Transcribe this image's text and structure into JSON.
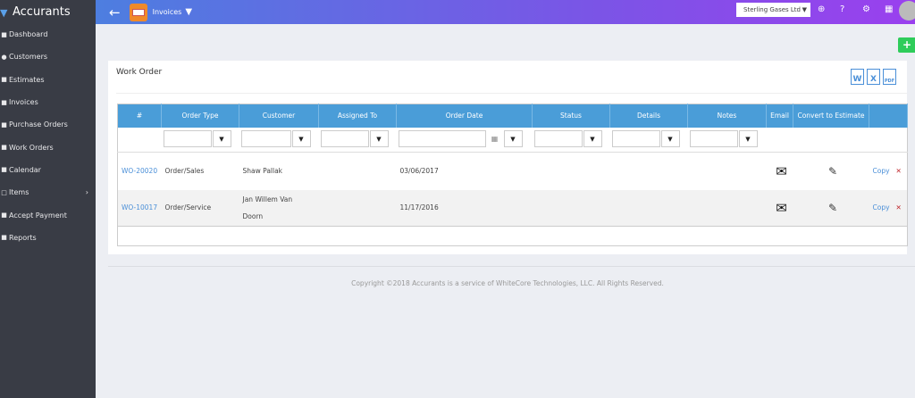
{
  "brand": "Accurants",
  "sidebar": {
    "items": [
      {
        "label": "Dashboard",
        "icon": "dashboard-icon"
      },
      {
        "label": "Customers",
        "icon": "user-icon"
      },
      {
        "label": "Estimates",
        "icon": "estimate-icon"
      },
      {
        "label": "Invoices",
        "icon": "invoice-icon"
      },
      {
        "label": "Purchase Orders",
        "icon": "purchase-icon"
      },
      {
        "label": "Work Orders",
        "icon": "workorder-icon"
      },
      {
        "label": "Calendar",
        "icon": "calendar-icon"
      },
      {
        "label": "Items",
        "icon": "items-icon",
        "has_submenu": true
      },
      {
        "label": "Accept Payment",
        "icon": "payment-icon"
      },
      {
        "label": "Reports",
        "icon": "reports-icon"
      }
    ]
  },
  "topbar": {
    "title": "Invoices",
    "company": "Sterling Gases Ltd",
    "colors": {
      "start": "#4d7ee0",
      "end": "#9a40ee"
    }
  },
  "card": {
    "title": "Work Order",
    "exports": [
      "W",
      "X",
      "PDF"
    ]
  },
  "table": {
    "headers": [
      "#",
      "Order Type",
      "Customer",
      "Assigned To",
      "Order Date",
      "Status",
      "Details",
      "Notes",
      "Email",
      "Convert to Estimate",
      ""
    ],
    "rows": [
      {
        "id": "WO-20020",
        "order_type": "Order/Sales",
        "customer": "Shaw Pallak",
        "assigned_to": "",
        "order_date": "03/06/2017",
        "copy": "Copy"
      },
      {
        "id": "WO-10017",
        "order_type": "Order/Service",
        "customer": "Jan Willem Van Doorn",
        "assigned_to": "",
        "order_date": "11/17/2016",
        "copy": "Copy"
      }
    ]
  },
  "footer": {
    "copyright": "Copyright ©2018 Accurants is a service of WhiteCore Technologies, LLC. All Rights Reserved."
  },
  "colors": {
    "sidebar": "#393c45",
    "table_header": "#4a9dd8",
    "add": "#2ecc5a",
    "link": "#4a8fd8",
    "delete": "#c0262b"
  }
}
